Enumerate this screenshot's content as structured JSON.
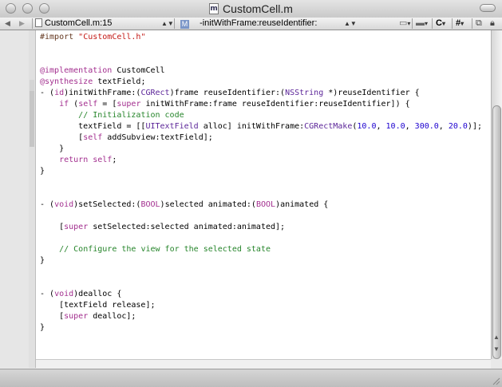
{
  "window": {
    "title": "CustomCell.m",
    "file_icon_letter": "m"
  },
  "navbar": {
    "file_selector": "CustomCell.m:15",
    "method_badge": "M",
    "method_selector": "-initWithFrame:reuseIdentifier:",
    "class_menu": "C",
    "pragma_menu": "#"
  },
  "editor": {
    "lines": [
      "#import \"CustomCell.h\"",
      "",
      "",
      "@implementation CustomCell",
      "@synthesize textField;",
      "- (id)initWithFrame:(CGRect)frame reuseIdentifier:(NSString *)reuseIdentifier {",
      "    if (self = [super initWithFrame:frame reuseIdentifier:reuseIdentifier]) {",
      "        // Initialization code",
      "        textField = [[UITextField alloc] initWithFrame:CGRectMake(10.0, 10.0, 300.0, 20.0)];",
      "        [self addSubview:textField];",
      "    }",
      "    return self;",
      "}",
      "",
      "",
      "- (void)setSelected:(BOOL)selected animated:(BOOL)animated {",
      "",
      "    [super setSelected:selected animated:animated];",
      "",
      "    // Configure the view for the selected state",
      "}",
      "",
      "",
      "- (void)dealloc {",
      "    [textField release];",
      "    [super dealloc];",
      "}"
    ]
  },
  "colors": {
    "keyword": "#a32f8f",
    "string": "#c41a16",
    "comment": "#26852b",
    "type": "#5c2699",
    "number": "#1c00cf"
  }
}
